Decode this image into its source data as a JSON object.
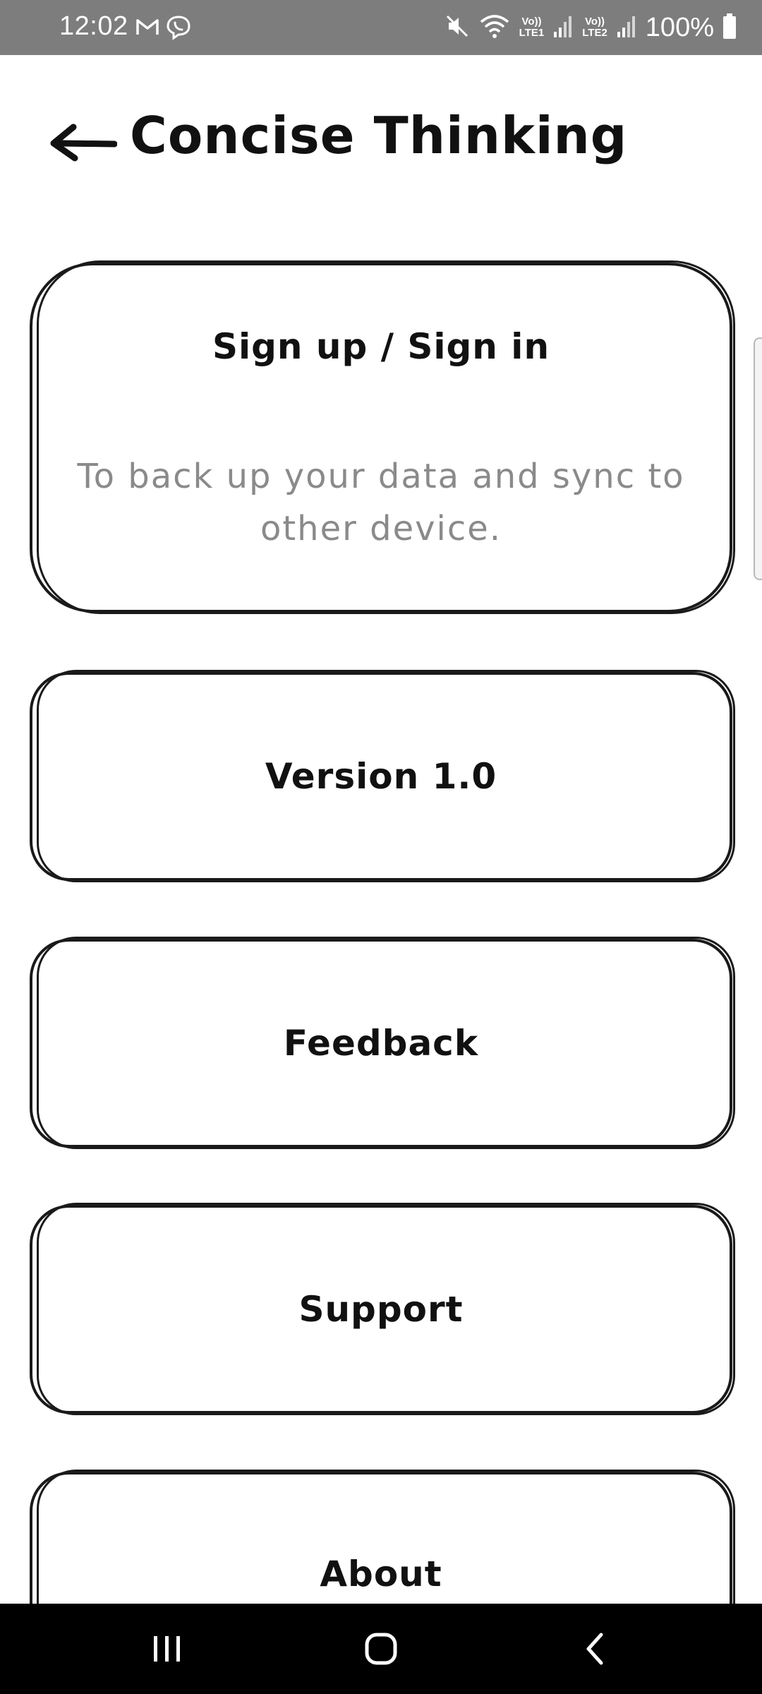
{
  "status_bar": {
    "time": "12:02",
    "left_icons": [
      "gmail-icon",
      "viber-icon"
    ],
    "right_icons": [
      "mute-icon",
      "wifi-icon",
      "signal-sim1-icon",
      "signal-sim2-icon",
      "battery-icon"
    ],
    "sim1_label_top": "Vo))",
    "sim1_label_bottom": "LTE1",
    "sim2_label_top": "Vo))",
    "sim2_label_bottom": "LTE2",
    "battery": "100%"
  },
  "header": {
    "back_icon": "back-arrow-icon",
    "title": "Concise Thinking"
  },
  "cards": {
    "signin": {
      "title": "Sign up / Sign in",
      "description": "To back up your data and sync to other device."
    },
    "version": {
      "title": "Version 1.0"
    },
    "feedback": {
      "title": "Feedback"
    },
    "support": {
      "title": "Support"
    },
    "about": {
      "title": "About"
    }
  },
  "nav_bar": {
    "icons": [
      "recents-icon",
      "home-icon",
      "back-icon"
    ]
  },
  "colors": {
    "status_bar_bg": "#7d7d7d",
    "text": "#111111",
    "muted_text": "#8a8a8a",
    "border": "#1a1a1a",
    "nav_bg": "#000000"
  }
}
